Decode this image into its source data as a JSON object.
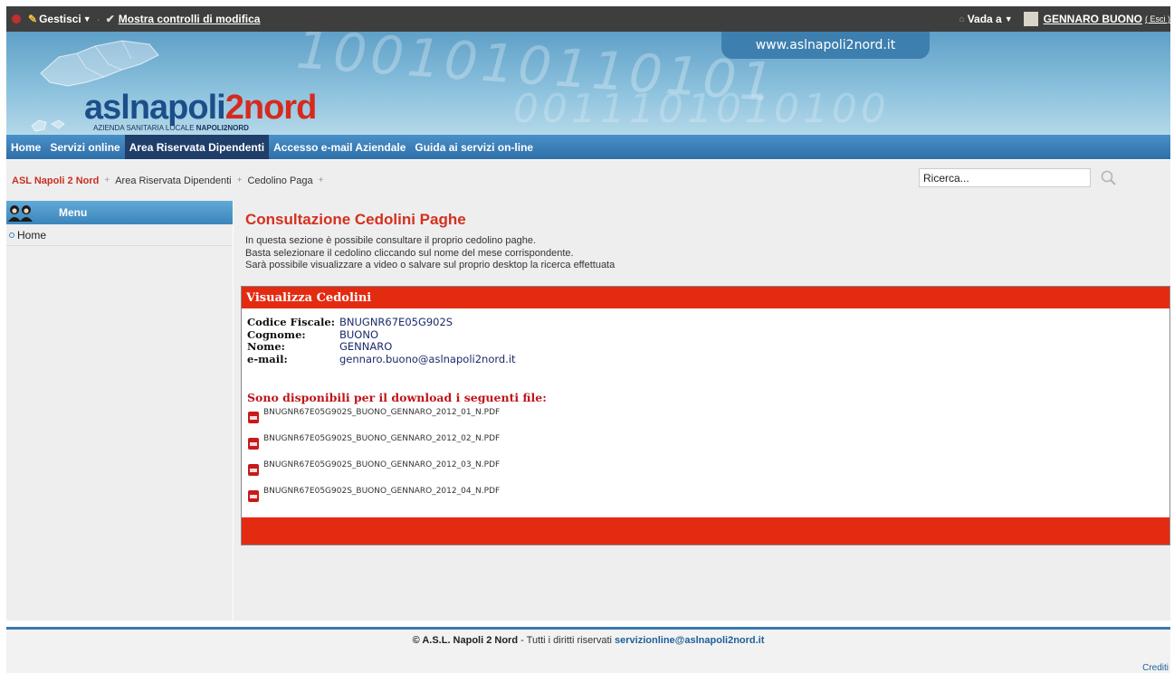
{
  "topbar": {
    "gestisci": "Gestisci",
    "mostra": "Mostra controlli di modifica",
    "vada": "Vada a",
    "user": "GENNARO BUONO",
    "esci": "( Esci )"
  },
  "banner": {
    "url": "www.aslnapoli2nord.it",
    "binary1": "1001010110101",
    "binary2": "0011101010100",
    "logo_asl": "asl",
    "logo_napoli": "napoli",
    "logo_2nord": "2nord",
    "logo_sub_prefix": "AZIENDA SANITARIA LOCALE ",
    "logo_sub_bold": "NAPOLI2NORD"
  },
  "nav": {
    "items": [
      "Home",
      "Servizi online",
      "Area Riservata Dipendenti",
      "Accesso e-mail Aziendale",
      "Guida ai servizi on-line"
    ]
  },
  "breadcrumb": {
    "items": [
      "ASL Napoli 2 Nord",
      "Area Riservata Dipendenti",
      "Cedolino Paga"
    ],
    "sep": "+"
  },
  "search": {
    "value": "Ricerca..."
  },
  "sidebar": {
    "title": "Menu",
    "items": [
      "Home"
    ]
  },
  "main": {
    "title": "Consultazione Cedolini Paghe",
    "desc": [
      "In questa sezione è possibile consultare il proprio cedolino paghe.",
      "Basta selezionare il cedolino cliccando sul nome del mese corrispondente.",
      "Sarà possibile visualizzare a video o salvare sul proprio desktop la ricerca effettuata"
    ],
    "panel_title": "Visualizza Cedolini",
    "fields": [
      {
        "label": "Codice Fiscale:",
        "value": "BNUGNR67E05G902S"
      },
      {
        "label": "Cognome:",
        "value": "BUONO"
      },
      {
        "label": "Nome:",
        "value": "GENNARO"
      },
      {
        "label": "e-mail:",
        "value": "gennaro.buono@aslnapoli2nord.it"
      }
    ],
    "downloads_title": "Sono disponibili per il download i seguenti file:",
    "files": [
      "BNUGNR67E05G902S_BUONO_GENNARO_2012_01_N.PDF",
      "BNUGNR67E05G902S_BUONO_GENNARO_2012_02_N.PDF",
      "BNUGNR67E05G902S_BUONO_GENNARO_2012_03_N.PDF",
      "BNUGNR67E05G902S_BUONO_GENNARO_2012_04_N.PDF"
    ]
  },
  "footer": {
    "copyright": "© A.S.L. Napoli 2 Nord",
    "rights": " - Tutti i diritti riservati ",
    "email": "servizionline@aslnapoli2nord.it",
    "crediti": "Crediti"
  },
  "colors": {
    "brand_blue": "#2f6fa8",
    "accent_red": "#e32b12",
    "title_red": "#d4301e"
  }
}
